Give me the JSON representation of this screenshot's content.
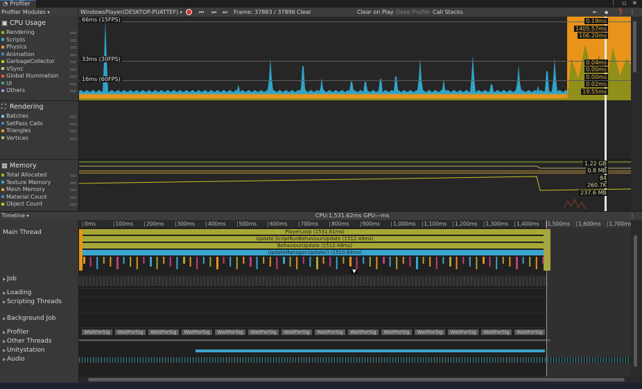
{
  "window": {
    "title": "Profiler",
    "controls": "⋮ ▫ ✕"
  },
  "toolbar": {
    "modules_label": "Profiler Modules",
    "target_label": "WindowsPlayer(DESKTOP-PUATTEF)",
    "frame_label": "Frame: 37883 / 37896",
    "clear_label": "Clear",
    "clear_on_play_label": "Clear on Play",
    "deep_profile_label": "Deep Profile",
    "call_stacks_label": "Call Stacks"
  },
  "colors": {
    "cpu_blue": "#2fa4c8",
    "cpu_orange": "#e8941a",
    "cpu_olive": "#8f8f1a",
    "accent": "#3a79bb"
  },
  "cpu": {
    "title": "CPU Usage",
    "legend": [
      {
        "label": "Rendering",
        "color": "#9bba26"
      },
      {
        "label": "Scripts",
        "color": "#3aa6d0"
      },
      {
        "label": "Physics",
        "color": "#e0a03a"
      },
      {
        "label": "Animation",
        "color": "#3f86c6"
      },
      {
        "label": "GarbageCollector",
        "color": "#c8c61e"
      },
      {
        "label": "VSync",
        "color": "#d3c18b"
      },
      {
        "label": "Global Illumination",
        "color": "#e65c3a"
      },
      {
        "label": "UI",
        "color": "#4a9e8a"
      },
      {
        "label": "Others",
        "color": "#b08ad8"
      }
    ],
    "grid": {
      "fps15": "66ms (15FPS)",
      "fps30": "33ms (30FPS)",
      "fps60": "16ms (60FPS)"
    },
    "values_top": [
      "0.19ms",
      "1405.57ms",
      "106.20ms"
    ],
    "values_bottom": [
      "0.04ms",
      "0.00ms",
      "0.00ms",
      "0.02ms",
      "19.55ms"
    ]
  },
  "rendering": {
    "title": "Rendering",
    "legend": [
      {
        "label": "Batches",
        "color": "#7fc2d8"
      },
      {
        "label": "SetPass Calls",
        "color": "#3f86c6"
      },
      {
        "label": "Triangles",
        "color": "#e0a03a"
      },
      {
        "label": "Vertices",
        "color": "#bfb96e"
      }
    ]
  },
  "memory": {
    "title": "Memory",
    "legend": [
      {
        "label": "Total Allocated",
        "color": "#9bba26"
      },
      {
        "label": "Texture Memory",
        "color": "#3aa6d0"
      },
      {
        "label": "Mesh Memory",
        "color": "#e0a03a"
      },
      {
        "label": "Material Count",
        "color": "#3f86c6"
      },
      {
        "label": "Object Count",
        "color": "#c8c61e"
      }
    ],
    "values": [
      "1.22 GB",
      "0.8 MB",
      "84",
      "260.7K",
      "237.6 MB"
    ]
  },
  "timeline": {
    "view_label": "Timeline",
    "stats": "CPU:1,531.62ms   GPU:--ms",
    "ruler": [
      "0ms",
      "100ms",
      "200ms",
      "300ms",
      "400ms",
      "500ms",
      "600ms",
      "700ms",
      "800ms",
      "900ms",
      "1,000ms",
      "1,100ms",
      "1,200ms",
      "1,300ms",
      "1,400ms",
      "1,500ms",
      "1,600ms",
      "1,700ms"
    ],
    "tracks": {
      "main": "Main Thread",
      "job": "Job",
      "loading": "Loading",
      "scripting": "Scripting Threads",
      "background": "Background Job",
      "profiler": "Profiler",
      "other": "Other Threads",
      "unity": "Unitystation",
      "audio": "Audio"
    },
    "samples": [
      "PlayerLoop (1531.61ms)",
      "Update.ScriptRunBehaviourUpdate (1512.49ms)",
      "BehaviourUpdate (1512.49ms)",
      "UpdateManager.Update() (1510.84ms)"
    ],
    "profiler_wait_label": "WaitForSig"
  }
}
